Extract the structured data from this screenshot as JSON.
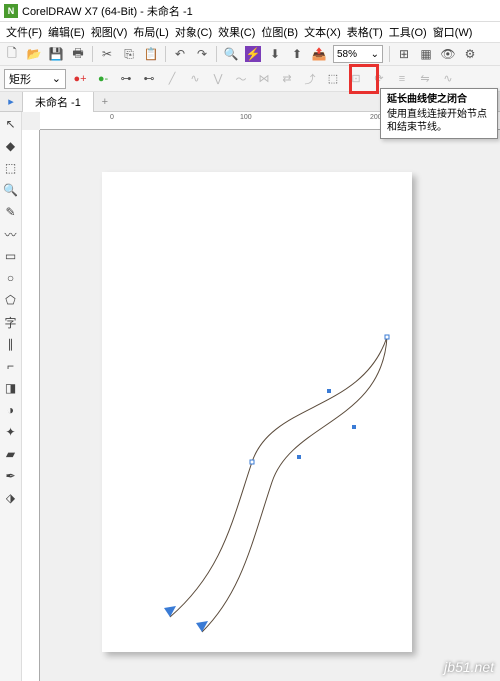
{
  "app": {
    "title": "CorelDRAW X7 (64-Bit) - 未命名 -1",
    "logo_letter": "N"
  },
  "menu": {
    "file": "文件(F)",
    "edit": "编辑(E)",
    "view": "视图(V)",
    "layout": "布局(L)",
    "object": "对象(C)",
    "effects": "效果(C)",
    "bitmap": "位图(B)",
    "text": "文本(X)",
    "table": "表格(T)",
    "tools": "工具(O)",
    "window": "窗口(W)"
  },
  "toolbar": {
    "zoom": "58%"
  },
  "propbar": {
    "shape_label": "矩形",
    "dd_arrow": "⌄"
  },
  "tooltip": {
    "title": "延长曲线使之闭合",
    "body": "使用直线连接开始节点和结束节线。"
  },
  "tabs": {
    "active": "未命名 -1",
    "add": "+"
  },
  "ruler": {
    "ticks": [
      "0",
      "100",
      "200"
    ]
  },
  "watermark": "jb51.net"
}
